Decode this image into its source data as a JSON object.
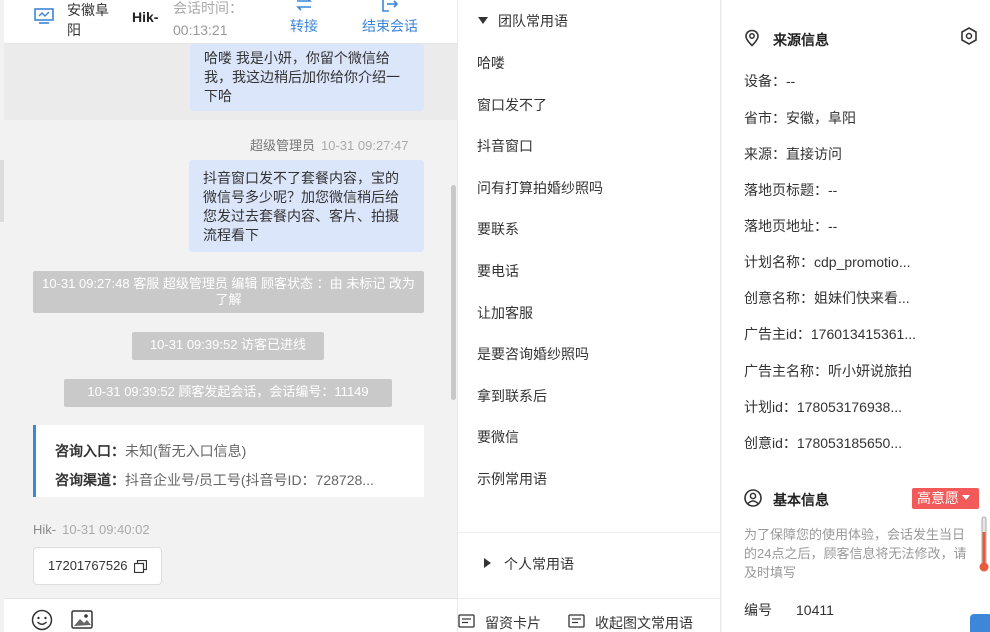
{
  "header": {
    "location": "安徽阜阳",
    "name": "Hik-",
    "time_label": "会话时间：",
    "time_value": "00:13:21",
    "transfer_label": "转接",
    "end_label": "结束会话"
  },
  "messages": {
    "bubble1": "哈喽 我是小妍，你留个微信给我，我这边稍后加你给你介绍一下哈",
    "sender2": "超级管理员",
    "sender2_time": "10-31 09:27:47",
    "bubble2": "抖音窗口发不了套餐内容，宝的微信号多少呢？加您微信稍后给您发过去套餐内容、客片、拍摄流程看下",
    "system1": "10-31 09:27:48 客服 超级管理员 编辑 顾客状态 ：由 未标记 改为 了解",
    "system2": "10-31 09:39:52 访客已进线",
    "system3": "10-31 09:39:52 顾客发起会话，会话编号：11149",
    "card_entry_label": "咨询入口：",
    "card_entry_value": "未知(暂无入口信息)",
    "card_channel_label": "咨询渠道：",
    "card_channel_value": "抖音企业号/员工号(抖音号ID：728728...",
    "visitor_name": "Hik-",
    "visitor_time": "10-31 09:40:02",
    "phone": "17201767526"
  },
  "phrases": {
    "team_title": "团队常用语",
    "items": [
      "哈喽",
      "窗口发不了",
      "抖音窗口",
      "问有打算拍婚纱照吗",
      "要联系",
      "要电话",
      "让加客服",
      "是要咨询婚纱照吗",
      "拿到联系后",
      "要微信",
      "示例常用语"
    ],
    "personal_title": "个人常用语"
  },
  "toolbar": {
    "card_label": "留资卡片",
    "collapse_label": "收起图文常用语"
  },
  "source_info": {
    "title": "来源信息",
    "device": "设备：--",
    "province": "省市：安徽，阜阳",
    "source": "来源：直接访问",
    "landing_title": "落地页标题：--",
    "landing_url": "落地页地址：--",
    "plan_name": "计划名称：cdp_promotio...",
    "creative_name": "创意名称：姐妹们快来看...",
    "advertiser_id": "广告主id：176013415361...",
    "advertiser_name": "广告主名称：听小妍说旅拍",
    "plan_id": "计划id：178053176938...",
    "creative_id": "创意id：178053185650..."
  },
  "basic_info": {
    "title": "基本信息",
    "intent_badge": "高意愿",
    "note": "为了保障您的使用体验，会话发生当日的24点之后，顾客信息将无法修改，请及时填写",
    "id_label": "编号",
    "id_value": "10411"
  },
  "colors": {
    "accent": "#3d86d8",
    "bubble": "#dbe6fb",
    "system_msg": "#c9c9c9",
    "badge": "#f25a5a"
  }
}
